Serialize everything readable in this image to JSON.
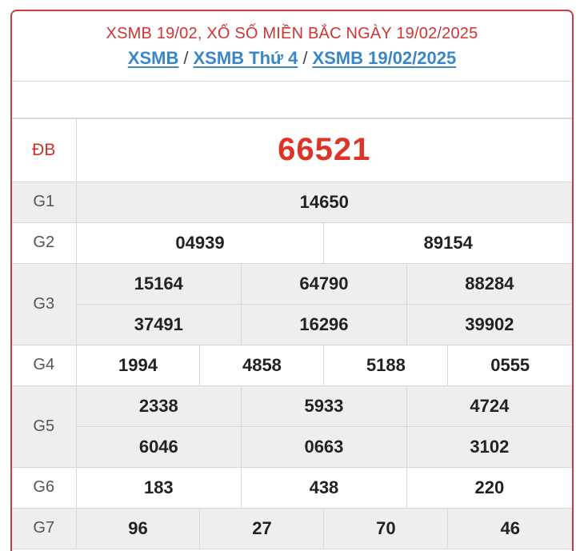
{
  "header": {
    "title": "XSMB 19/02, XỔ SỐ MIỀN BẮC NGÀY 19/02/2025",
    "breadcrumb": [
      "XSMB",
      "XSMB Thứ 4",
      "XSMB 19/02/2025"
    ],
    "separator": "/"
  },
  "prizes": {
    "db": {
      "label": "ĐB",
      "values": [
        "66521"
      ]
    },
    "g1": {
      "label": "G1",
      "values": [
        "14650"
      ]
    },
    "g2": {
      "label": "G2",
      "values": [
        "04939",
        "89154"
      ]
    },
    "g3": {
      "label": "G3",
      "values": [
        "15164",
        "64790",
        "88284",
        "37491",
        "16296",
        "39902"
      ]
    },
    "g4": {
      "label": "G4",
      "values": [
        "1994",
        "4858",
        "5188",
        "0555"
      ]
    },
    "g5": {
      "label": "G5",
      "values": [
        "2338",
        "5933",
        "4724",
        "6046",
        "0663",
        "3102"
      ]
    },
    "g6": {
      "label": "G6",
      "values": [
        "183",
        "438",
        "220"
      ]
    },
    "g7": {
      "label": "G7",
      "values": [
        "96",
        "27",
        "70",
        "46"
      ]
    }
  },
  "colors": {
    "accent": "#cf3a3a",
    "special_number": "#de3428",
    "link": "#3b86c6",
    "row_shade": "#eeeeee"
  }
}
